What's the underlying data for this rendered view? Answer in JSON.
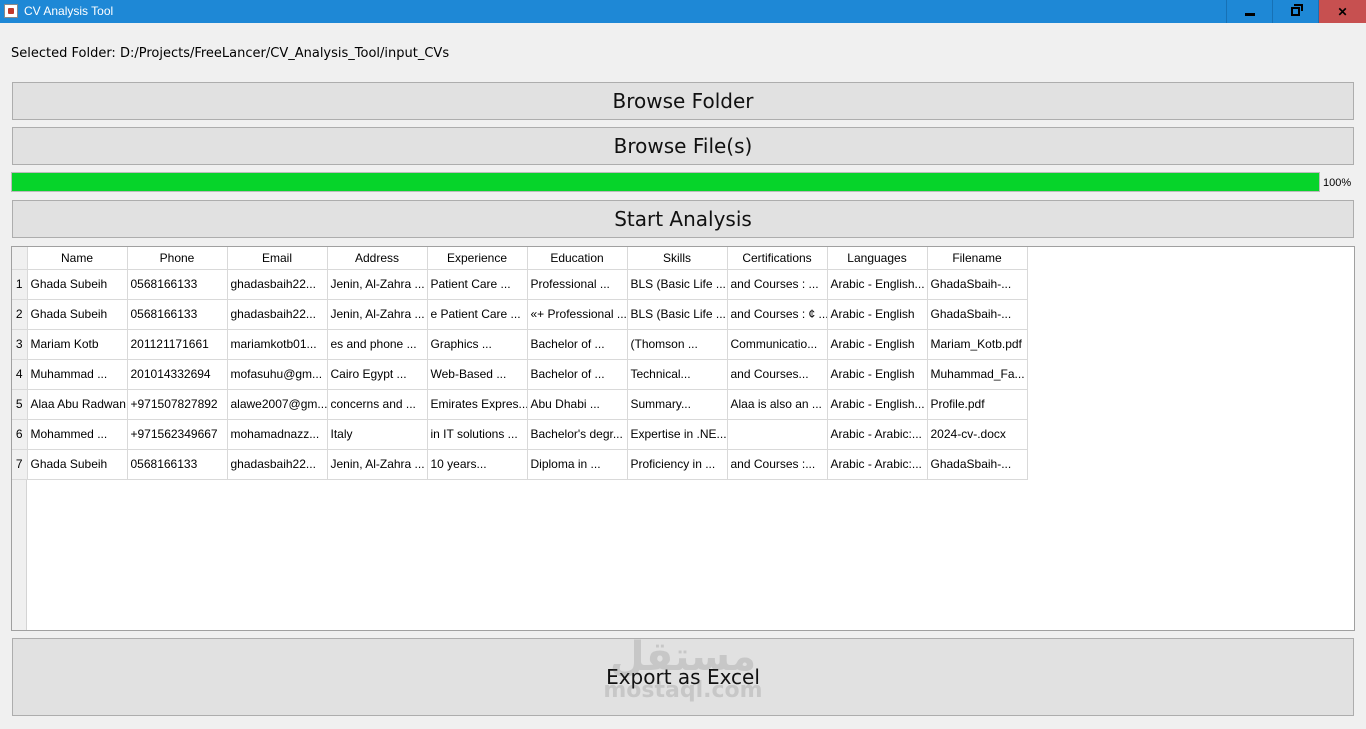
{
  "window": {
    "title": "CV Analysis Tool"
  },
  "folder": {
    "label": "Selected Folder: D:/Projects/FreeLancer/CV_Analysis_Tool/input_CVs"
  },
  "buttons": {
    "browse_folder": "Browse Folder",
    "browse_files": "Browse File(s)",
    "start_analysis": "Start Analysis",
    "export_excel": "Export as Excel"
  },
  "progress": {
    "value": 100,
    "text": "100%"
  },
  "table": {
    "columns": [
      "Name",
      "Phone",
      "Email",
      "Address",
      "Experience",
      "Education",
      "Skills",
      "Certifications",
      "Languages",
      "Filename"
    ],
    "rows": [
      {
        "num": "1",
        "cells": [
          "Ghada Subeih",
          "0568166133",
          "ghadasbaih22...",
          "Jenin, Al-Zahra ...",
          "Patient Care ...",
          "Professional ...",
          "BLS (Basic Life ...",
          "and Courses : ...",
          "Arabic - English...",
          "GhadaSbaih-..."
        ]
      },
      {
        "num": "2",
        "cells": [
          "Ghada Subeih",
          "0568166133",
          "ghadasbaih22...",
          "Jenin, Al-Zahra ...",
          "e Patient Care ...",
          "«+ Professional ...",
          "BLS (Basic Life ...",
          "and Courses : ¢ ...",
          "Arabic - English",
          "GhadaSbaih-..."
        ]
      },
      {
        "num": "3",
        "cells": [
          "Mariam Kotb",
          "201121171661",
          "mariamkotb01...",
          "es and phone ...",
          "Graphics ...",
          "Bachelor of ...",
          "(Thomson ...",
          "Communicatio...",
          "Arabic - English",
          "Mariam_Kotb.pdf"
        ]
      },
      {
        "num": "4",
        "cells": [
          "Muhammad ...",
          "201014332694",
          "mofasuhu@gm...",
          "Cairo Egypt ...",
          "Web-Based ...",
          "Bachelor of ...",
          "Technical...",
          "and Courses...",
          "Arabic - English",
          "Muhammad_Fa..."
        ]
      },
      {
        "num": "5",
        "cells": [
          "Alaa Abu Radwan",
          "+971507827892",
          "alawe2007@gm...",
          "concerns and ...",
          "Emirates Expres...",
          "Abu Dhabi ...",
          "Summary...",
          "Alaa is also an ...",
          "Arabic - English...",
          "Profile.pdf"
        ]
      },
      {
        "num": "6",
        "cells": [
          "Mohammed ...",
          "+971562349667",
          "mohamadnazz...",
          "Italy",
          "in IT solutions ...",
          "Bachelor's degr...",
          "Expertise in .NE...",
          "",
          "Arabic - Arabic:...",
          "2024-cv-.docx"
        ]
      },
      {
        "num": "7",
        "cells": [
          "Ghada Subeih",
          "0568166133",
          "ghadasbaih22...",
          "Jenin, Al-Zahra ...",
          "10 years...",
          "Diploma in ...",
          "Proficiency in ...",
          "and Courses :...",
          "Arabic - Arabic:...",
          "GhadaSbaih-..."
        ]
      }
    ]
  },
  "watermark": {
    "arabic": "مستقل",
    "latin": "mostaql.com"
  }
}
